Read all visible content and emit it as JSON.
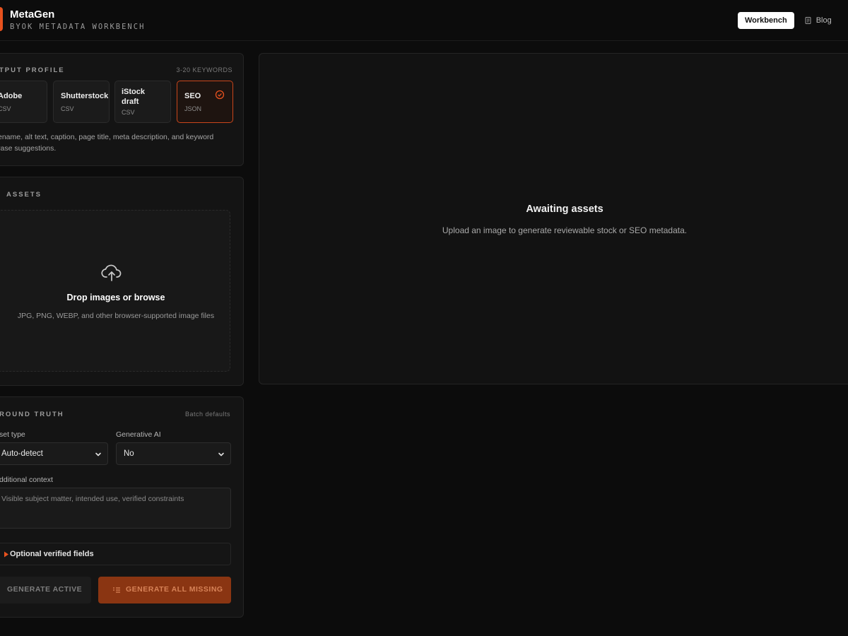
{
  "app": {
    "title": "MetaGen",
    "subtitle": "BYOK METADATA WORKBENCH"
  },
  "nav": {
    "workbench_label": "Workbench",
    "blog_label": "Blog",
    "blog_icon": "document-icon"
  },
  "output_profile": {
    "label": "TPUT PROFILE",
    "meta": "3-20 KEYWORDS",
    "cards": [
      {
        "name": "Adobe",
        "format": "CSV",
        "selected": false
      },
      {
        "name": "Shutterstock",
        "format": "CSV",
        "selected": false
      },
      {
        "name": "iStock draft",
        "format": "CSV",
        "selected": false
      },
      {
        "name": "SEO",
        "format": "JSON",
        "selected": true
      }
    ],
    "description": "ename, alt text, caption, page title, meta description, and keyword rase suggestions."
  },
  "assets": {
    "label": "ASSETS",
    "drop_title": "Drop images or browse",
    "drop_subtitle": "JPG, PNG, WEBP, and other browser-supported image files",
    "icon": "cloud-upload-icon"
  },
  "ground_truth": {
    "label": "ROUND TRUTH",
    "meta": "Batch defaults",
    "asset_type_label": "set type",
    "asset_type_value": "Auto-detect",
    "generative_ai_label": "Generative AI",
    "generative_ai_value": "No",
    "context_label": "dditional context",
    "context_placeholder": "Visible subject matter, intended use, verified constraints",
    "optional_fields_label": "Optional verified fields"
  },
  "actions": {
    "generate_active": "GENERATE ACTIVE",
    "generate_all_missing": "GENERATE ALL MISSING"
  },
  "preview": {
    "title": "Awaiting assets",
    "subtitle": "Upload an image to generate reviewable stock or SEO metadata."
  },
  "colors": {
    "accent": "#e8521e",
    "accent_dark": "#8a3512",
    "background": "#0c0c0c",
    "panel": "#141414"
  }
}
